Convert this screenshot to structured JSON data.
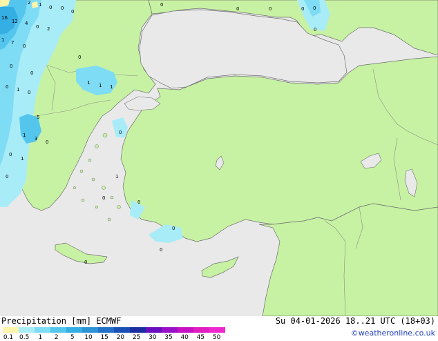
{
  "map": {
    "colors": {
      "sea": "#e9e9e9",
      "land": "#c7f2a3",
      "border": "#8a8a8a",
      "coast": "#6e6e6e"
    },
    "labels": [
      "16",
      "12",
      "4",
      "2",
      "1",
      "0",
      "1",
      "7",
      "0",
      "2",
      "0",
      "0",
      "0",
      "0",
      "0",
      "0",
      "1",
      "1",
      "1",
      "0",
      "1",
      "0",
      "5",
      "1",
      "3",
      "0",
      "0",
      "0",
      "1",
      "0",
      "1",
      "0",
      "0",
      "0",
      "0",
      "0",
      "0",
      "0",
      "0",
      "0",
      "0",
      "0"
    ]
  },
  "footer": {
    "left": "Precipitation [mm] ECMWF",
    "right": "Su 04-01-2026 18..21 UTC (18+03)",
    "credit": "©weatheronline.co.uk"
  },
  "legend": {
    "colors": [
      "#fff5a8",
      "#a8ecf8",
      "#7edcf4",
      "#54c6ee",
      "#35aee4",
      "#2b92d6",
      "#2370c8",
      "#1a50b6",
      "#1a2ea0",
      "#6a0fc0",
      "#9a10c8",
      "#c612c4",
      "#e11cc0",
      "#f028d0"
    ],
    "ticks": [
      "0.1",
      "0.5",
      "1",
      "2",
      "5",
      "10",
      "15",
      "20",
      "25",
      "30",
      "35",
      "40",
      "45",
      "50"
    ]
  }
}
